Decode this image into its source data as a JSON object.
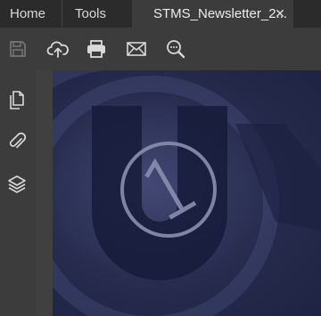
{
  "tabs": {
    "home_label": "Home",
    "tools_label": "Tools",
    "document_label": "STMS_Newsletter_2...",
    "close_glyph": "✕"
  },
  "toolbar": {
    "icons": [
      "save-icon",
      "cloud-upload-icon",
      "print-icon",
      "mail-icon",
      "search-zoom-icon"
    ]
  },
  "sidebar": {
    "icons": [
      "pages-icon",
      "attachment-icon",
      "layers-icon"
    ]
  },
  "colors": {
    "tabbar_bg": "#2b2b2b",
    "panel_bg": "#3c3c3c",
    "icon": "#d9d9d9",
    "page_dark_blue": "#262b4d"
  }
}
